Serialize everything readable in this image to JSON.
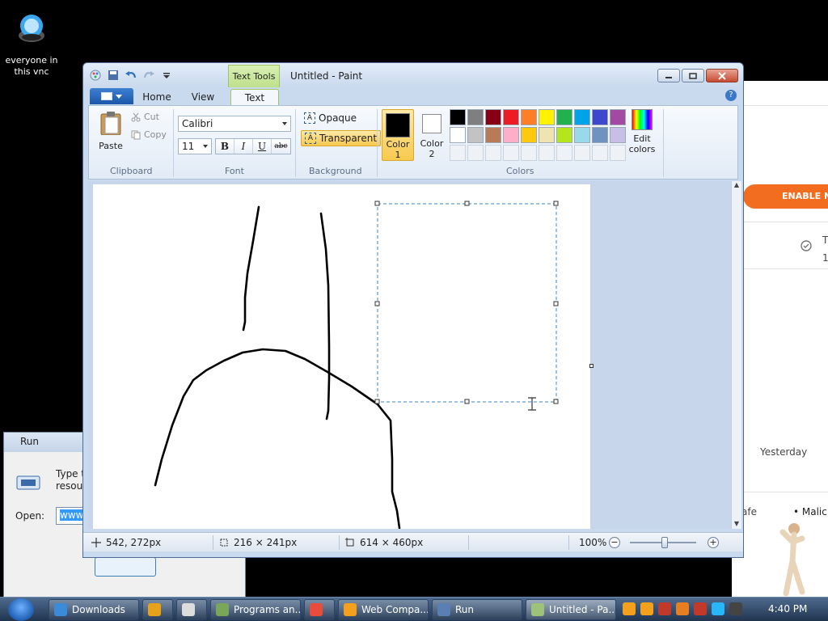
{
  "desktop": {
    "icon_label": "everyone in this vnc"
  },
  "webpage": {
    "enable_button": "ENABLE N",
    "row_title_fragment": "T",
    "row_number_fragment": "1",
    "yesterday": "Yesterday",
    "safe_fragment": "afe",
    "malic_fragment": "• Malic"
  },
  "run_dialog": {
    "title": "Run",
    "description_line1": "Type t",
    "description_line2": "resour",
    "open_label": "Open:",
    "open_value": "www"
  },
  "paint": {
    "window_title": "Untitled - Paint",
    "contextual_tab": "Text Tools",
    "tabs": {
      "home": "Home",
      "view": "View",
      "text": "Text"
    },
    "help": "?",
    "clipboard": {
      "paste": "Paste",
      "cut": "Cut",
      "copy": "Copy",
      "group_label": "Clipboard"
    },
    "font": {
      "family": "Calibri",
      "size": "11",
      "bold": "B",
      "italic": "I",
      "underline": "U",
      "strikethrough": "abc",
      "group_label": "Font"
    },
    "background": {
      "opaque": "Opaque",
      "transparent": "Transparent",
      "group_label": "Background"
    },
    "colors": {
      "color1_label_line1": "Color",
      "color1_label_line2": "1",
      "color2_label_line1": "Color",
      "color2_label_line2": "2",
      "edit_colors_line1": "Edit",
      "edit_colors_line2": "colors",
      "group_label": "Colors",
      "color1_value": "#000000",
      "color2_value": "#ffffff",
      "palette_row1": [
        "#000000",
        "#7f7f7f",
        "#880015",
        "#ed1c24",
        "#ff7f27",
        "#fff200",
        "#22b14c",
        "#00a2e8",
        "#3f48cc",
        "#a349a4"
      ],
      "palette_row2": [
        "#ffffff",
        "#c3c3c3",
        "#b97a57",
        "#ffaec9",
        "#ffc90e",
        "#efe4b0",
        "#b5e61d",
        "#99d9ea",
        "#7092be",
        "#c8bfe7"
      ],
      "palette_row3_empty": 10
    },
    "status": {
      "cursor_position": "542, 272px",
      "selection_size": "216 × 241px",
      "canvas_size": "614 × 460px",
      "zoom": "100%"
    }
  },
  "taskbar": {
    "buttons": [
      {
        "label": "Downloads",
        "icon": "ie-icon",
        "color": "#3a8bd8"
      },
      {
        "label": "",
        "icon": "media-player-icon",
        "color": "#e8a21a"
      },
      {
        "label": "",
        "icon": "window-switch-icon",
        "color": "#dddddd"
      },
      {
        "label": "Programs an...",
        "icon": "control-panel-icon",
        "color": "#7aa65a"
      },
      {
        "label": "",
        "icon": "chrome-icon",
        "color": "#e84c3d"
      },
      {
        "label": "Web Compa...",
        "icon": "shield-icon",
        "color": "#f3a11c"
      },
      {
        "label": "Run",
        "icon": "run-icon",
        "color": "#5a7fb5"
      },
      {
        "label": "Untitled - Pa...",
        "icon": "paint-icon",
        "color": "#9ec27a"
      }
    ],
    "tray_icons": [
      "#f3a11c",
      "#f3a11c",
      "#c0392b",
      "#e67e22",
      "#c0392b",
      "#29b6f6",
      "#444444"
    ],
    "clock": "4:40 PM"
  }
}
